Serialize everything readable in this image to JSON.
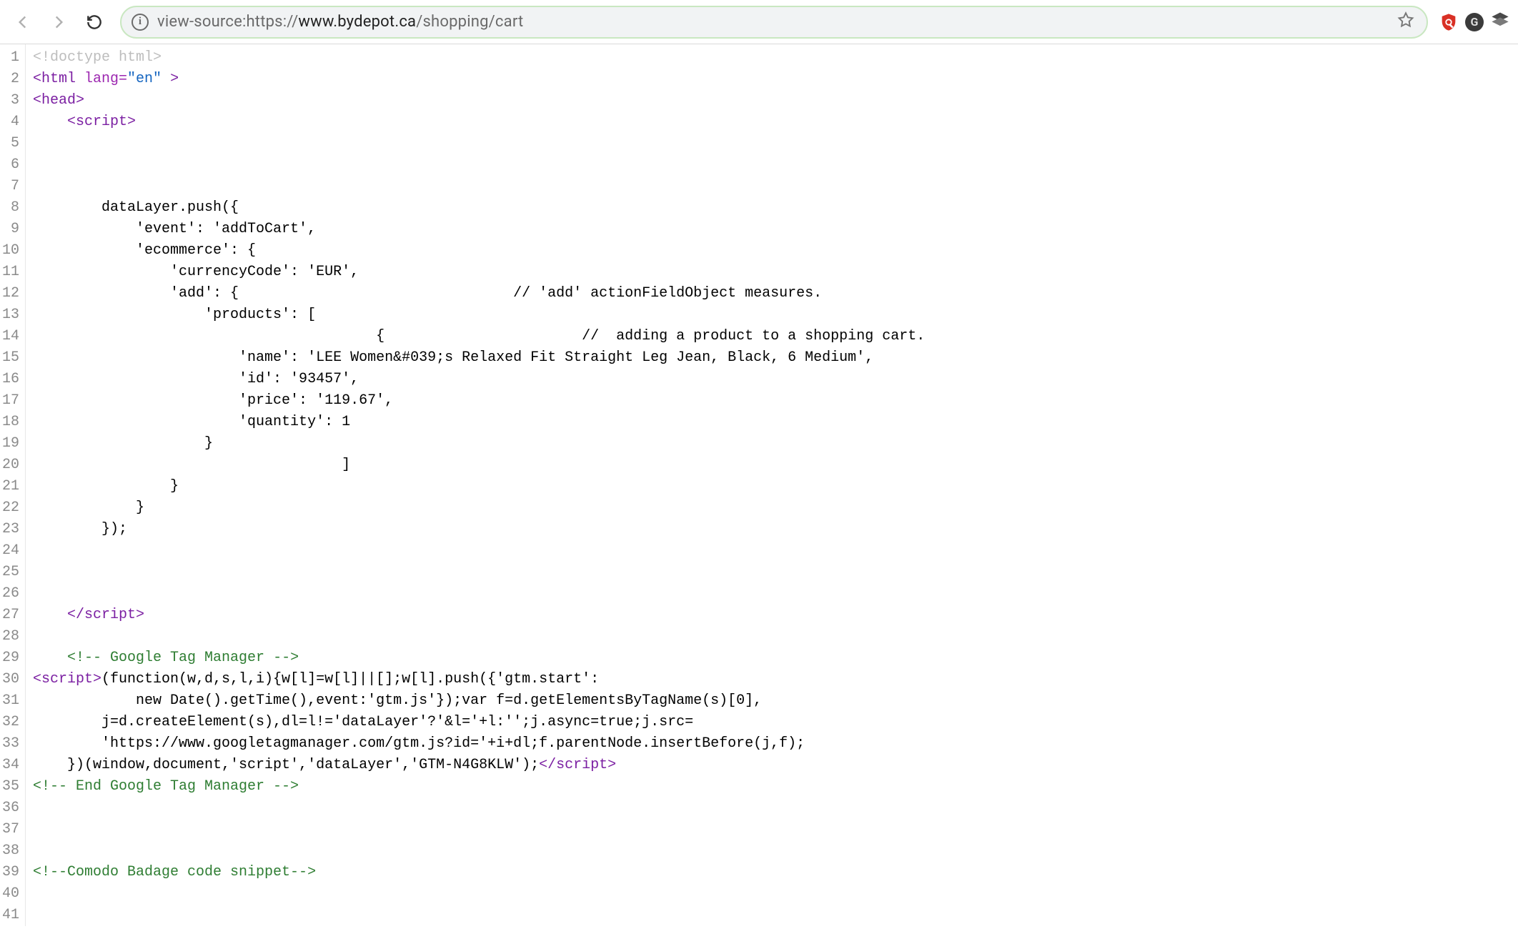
{
  "toolbar": {
    "url_prefix": "view-source:https://",
    "url_host": "www.bydepot.ca",
    "url_path": "/shopping/cart",
    "info_glyph": "i",
    "ghost_glyph": "G"
  },
  "source": {
    "total_lines": 41,
    "lines": [
      {
        "n": 1,
        "kind": "doctype",
        "text": "<!doctype html>"
      },
      {
        "n": 2,
        "kind": "html_open"
      },
      {
        "n": 3,
        "kind": "tag_open",
        "tag": "head"
      },
      {
        "n": 4,
        "kind": "tag_indent_open",
        "indent": "    ",
        "tag": "script"
      },
      {
        "n": 5,
        "kind": "blank"
      },
      {
        "n": 6,
        "kind": "blank"
      },
      {
        "n": 7,
        "kind": "blank"
      },
      {
        "n": 8,
        "kind": "plain",
        "text": "        dataLayer.push({"
      },
      {
        "n": 9,
        "kind": "plain",
        "text": "            'event': 'addToCart',"
      },
      {
        "n": 10,
        "kind": "plain",
        "text": "            'ecommerce': {"
      },
      {
        "n": 11,
        "kind": "plain",
        "text": "                'currencyCode': 'EUR',"
      },
      {
        "n": 12,
        "kind": "plain",
        "text": "                'add': {                                // 'add' actionFieldObject measures."
      },
      {
        "n": 13,
        "kind": "plain",
        "text": "                    'products': ["
      },
      {
        "n": 14,
        "kind": "plain",
        "text": "                                        {                       //  adding a product to a shopping cart."
      },
      {
        "n": 15,
        "kind": "plain",
        "text": "                        'name': 'LEE Women&#039;s Relaxed Fit Straight Leg Jean, Black, 6 Medium',"
      },
      {
        "n": 16,
        "kind": "plain",
        "text": "                        'id': '93457',"
      },
      {
        "n": 17,
        "kind": "plain",
        "text": "                        'price': '119.67',"
      },
      {
        "n": 18,
        "kind": "plain",
        "text": "                        'quantity': 1"
      },
      {
        "n": 19,
        "kind": "plain",
        "text": "                    }"
      },
      {
        "n": 20,
        "kind": "plain",
        "text": "                                    ]"
      },
      {
        "n": 21,
        "kind": "plain",
        "text": "                }"
      },
      {
        "n": 22,
        "kind": "plain",
        "text": "            }"
      },
      {
        "n": 23,
        "kind": "plain",
        "text": "        });"
      },
      {
        "n": 24,
        "kind": "blank"
      },
      {
        "n": 25,
        "kind": "blank"
      },
      {
        "n": 26,
        "kind": "blank"
      },
      {
        "n": 27,
        "kind": "tag_indent_close",
        "indent": "    ",
        "tag": "script"
      },
      {
        "n": 28,
        "kind": "blank"
      },
      {
        "n": 29,
        "kind": "comment",
        "indent": "    ",
        "text": "<!-- Google Tag Manager -->"
      },
      {
        "n": 30,
        "kind": "gtm_open",
        "text_after": "(function(w,d,s,l,i){w[l]=w[l]||[];w[l].push({'gtm.start':"
      },
      {
        "n": 31,
        "kind": "plain",
        "text": "            new Date().getTime(),event:'gtm.js'});var f=d.getElementsByTagName(s)[0],"
      },
      {
        "n": 32,
        "kind": "plain",
        "text": "        j=d.createElement(s),dl=l!='dataLayer'?'&l='+l:'';j.async=true;j.src="
      },
      {
        "n": 33,
        "kind": "plain",
        "text": "        'https://www.googletagmanager.com/gtm.js?id='+i+dl;f.parentNode.insertBefore(j,f);"
      },
      {
        "n": 34,
        "kind": "gtm_close",
        "text_before": "    })(window,document,'script','dataLayer','GTM-N4G8KLW');"
      },
      {
        "n": 35,
        "kind": "comment",
        "indent": "",
        "text": "<!-- End Google Tag Manager -->"
      },
      {
        "n": 36,
        "kind": "blank"
      },
      {
        "n": 37,
        "kind": "blank"
      },
      {
        "n": 38,
        "kind": "blank"
      },
      {
        "n": 39,
        "kind": "comment",
        "indent": "",
        "text": "<!--Comodo Badage code snippet-->"
      },
      {
        "n": 40,
        "kind": "blank"
      },
      {
        "n": 41,
        "kind": "blank"
      }
    ]
  }
}
